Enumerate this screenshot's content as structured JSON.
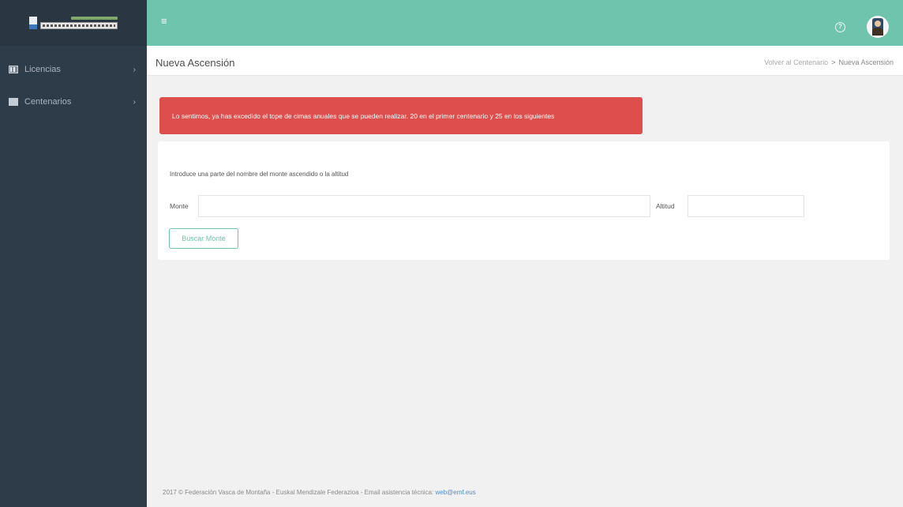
{
  "sidebar": {
    "items": [
      {
        "label": "Licencias",
        "icon": "license-grid-icon"
      },
      {
        "label": "Centenarios",
        "icon": "square-icon"
      }
    ]
  },
  "topbar": {
    "menu_icon": "hamburger-icon",
    "help_icon": "help-circle-icon",
    "accent_color": "#6ec4ac"
  },
  "header": {
    "title": "Nueva Ascensión",
    "breadcrumb": {
      "link": "Volver al Centenario",
      "separator": ">",
      "current": "Nueva Ascensión"
    }
  },
  "alert": {
    "message": "Lo sentimos, ya has excedido el tope de cimas anuales que se pueden realizar. 20 en el primer centenario y 25 en los siguientes",
    "color": "#dd4e4c"
  },
  "search_form": {
    "intro": "Introduce una parte del nombre del monte ascendido o la altitud",
    "monte_label": "Monte",
    "monte_value": "",
    "altitud_label": "Altitud",
    "altitud_value": "",
    "button_label": "Buscar Monte"
  },
  "footer": {
    "text": "2017 © Federación Vasca de Montaña - Euskal Mendizale Federazioa - Email asistencia técnica:",
    "email": "web@emf.eus"
  }
}
